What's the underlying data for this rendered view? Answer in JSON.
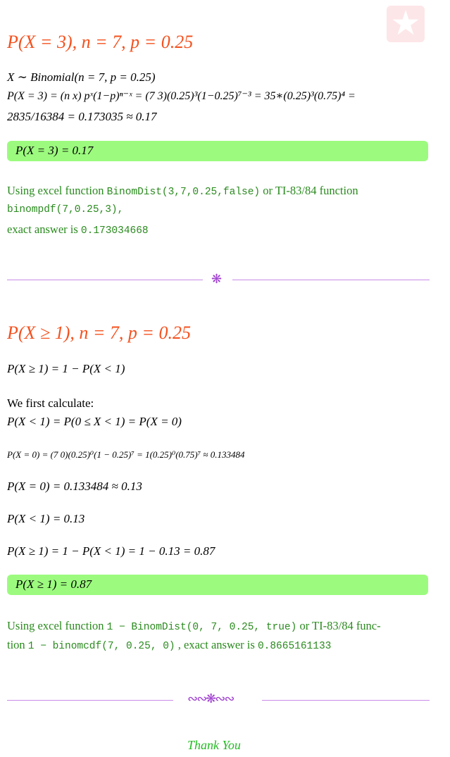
{
  "logo": "star-logo",
  "section1": {
    "title": "P(X = 3), n = 7, p = 0.25",
    "line1": "X ∼ Binomial(n = 7, p = 0.25)",
    "line2": "P(X = 3) = (n x) pˣ(1−p)ⁿ⁻ˣ = (7 3)(0.25)³(1−0.25)⁷⁻³ = 35∗(0.25)³(0.75)⁴ =",
    "line3": "2835/16384 = 0.173035 ≈ 0.17",
    "result": "P(X = 3) = 0.17",
    "note1a": "Using excel function ",
    "note1b": "BinomDist(3,7,0.25,false)",
    "note1c": " or TI-83/84 function",
    "note2": "binompdf(7,0.25,3),",
    "note3a": "exact answer is ",
    "note3b": "0.173034668"
  },
  "section2": {
    "title": "P(X ≥ 1), n = 7, p = 0.25",
    "line1": "P(X ≥ 1) = 1 − P(X < 1)",
    "line2": "We first calculate:",
    "line3": "P(X < 1) = P(0 ≤ X < 1) = P(X = 0)",
    "line4": "P(X = 0) = (7 0)(0.25)⁰(1 − 0.25)⁷ = 1(0.25)⁰(0.75)⁷ ≈ 0.133484",
    "line5": "P(X = 0) = 0.133484 ≈ 0.13",
    "line6": "P(X < 1) = 0.13",
    "line7": "P(X ≥ 1) = 1 − P(X < 1) = 1 − 0.13 = 0.87",
    "result": "P(X ≥ 1) = 0.87",
    "note1a": "Using excel function ",
    "note1b": "1 − BinomDist(0, 7, 0.25, true)",
    "note1c": " or TI-83/84 func-",
    "note2a": "tion ",
    "note2b": "1 − binomcdf(7, 0.25, 0)",
    "note2c": " , exact answer is ",
    "note2d": "0.8665161133"
  },
  "footer": {
    "thanks": "Thank You"
  }
}
